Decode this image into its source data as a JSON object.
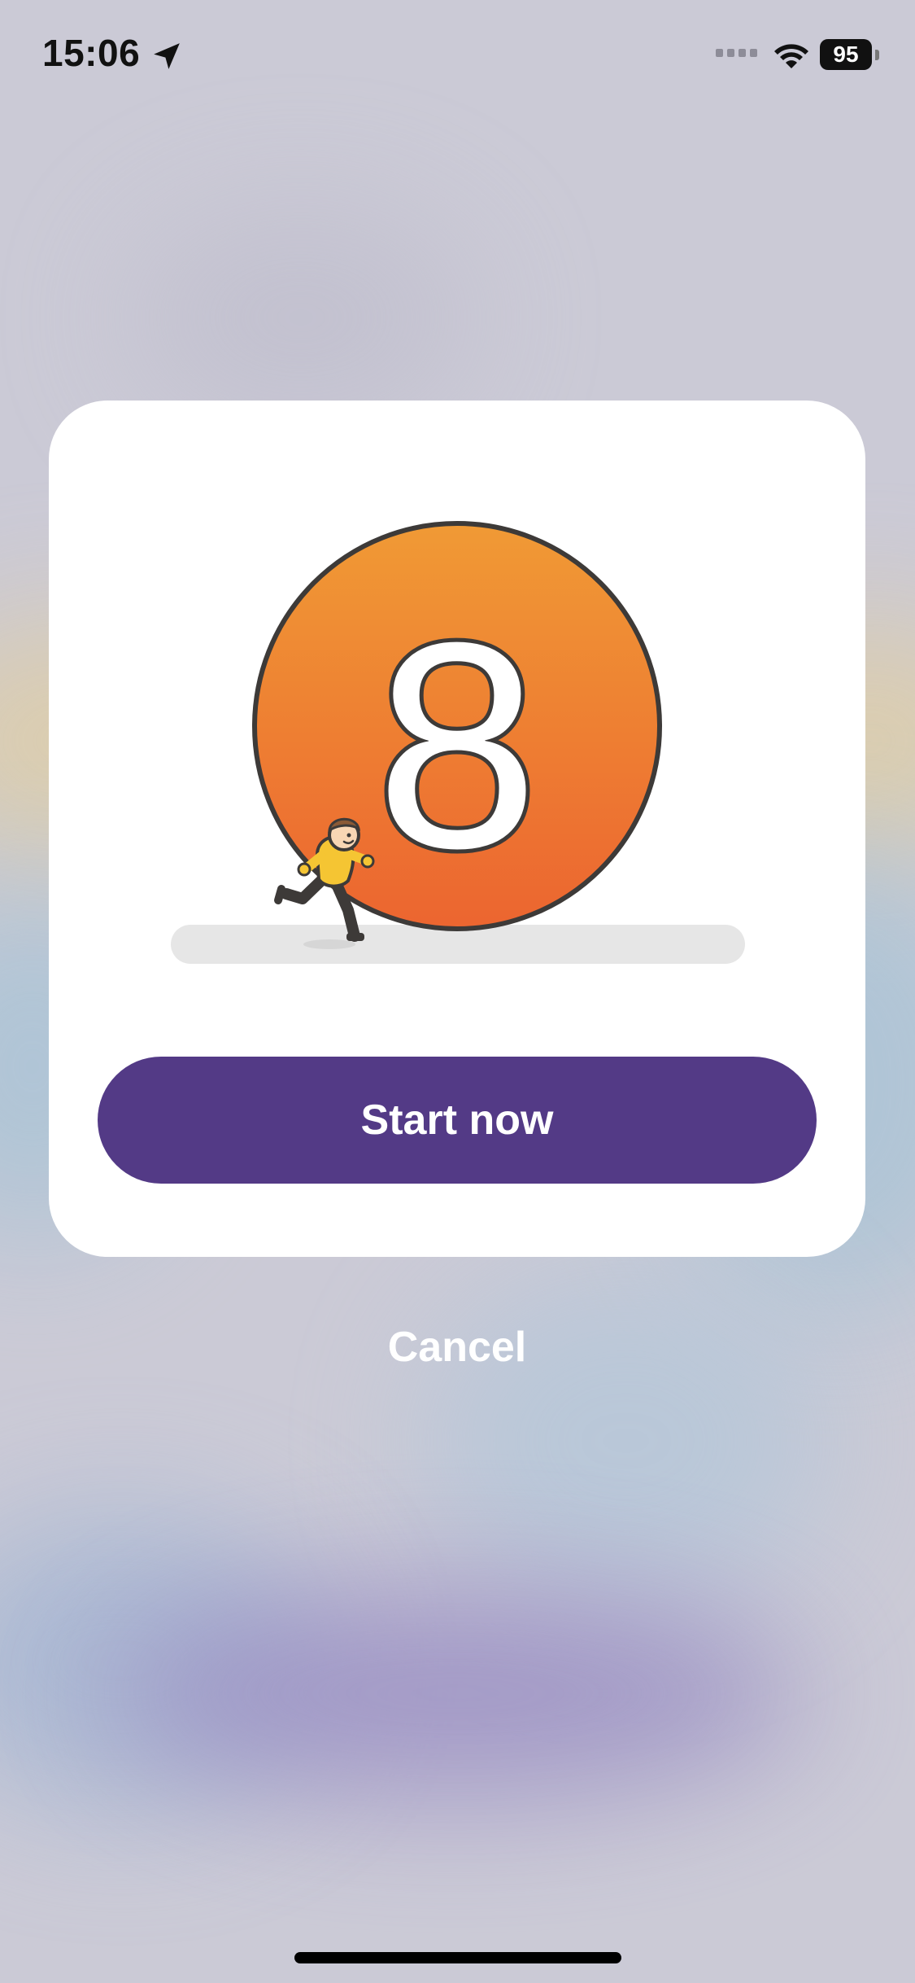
{
  "status_bar": {
    "time": "15:06",
    "battery": "95",
    "icons": [
      "location-arrow-icon",
      "signal-icon",
      "wifi-icon",
      "battery-icon"
    ]
  },
  "modal": {
    "countdown_number": "8",
    "illustration": "running-person-illustration",
    "start_label": "Start now"
  },
  "cancel_label": "Cancel",
  "colors": {
    "accent": "#533a86",
    "circle_top": "#f09a35",
    "circle_bottom": "#ec6530",
    "background": "#cbcad6"
  }
}
